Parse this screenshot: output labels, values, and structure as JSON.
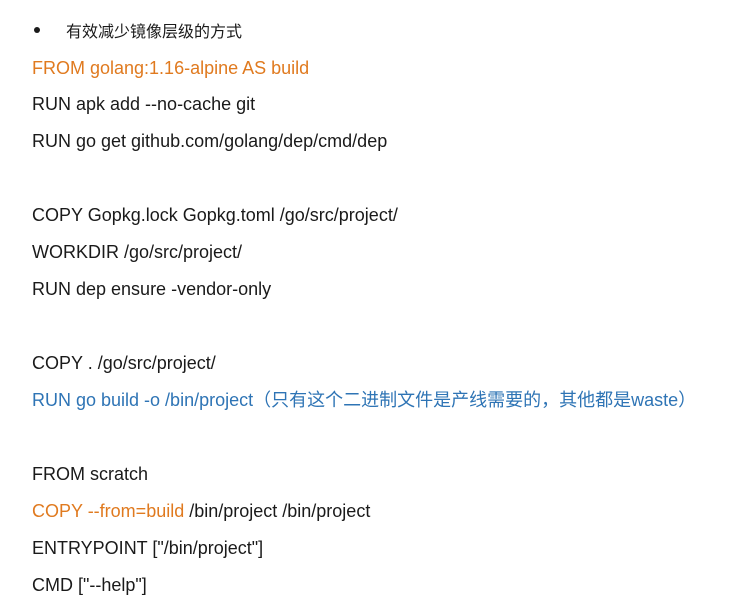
{
  "heading": "有效减少镜像层级的方式",
  "lines": {
    "l1": "FROM golang:1.16-alpine AS build",
    "l2": "RUN apk add --no-cache git",
    "l3": "RUN go get github.com/golang/dep/cmd/dep",
    "l4": "COPY Gopkg.lock Gopkg.toml /go/src/project/",
    "l5": "WORKDIR /go/src/project/",
    "l6": "RUN dep ensure -vendor-only",
    "l7": "COPY . /go/src/project/",
    "l8": "RUN go build -o /bin/project（只有这个二进制文件是产线需要的，其他都是waste）",
    "l9": "FROM scratch",
    "l10_highlight": "COPY --from=build",
    "l10_rest": " /bin/project /bin/project",
    "l11": "ENTRYPOINT [\"/bin/project\"]",
    "l12": "CMD [\"--help\"]"
  },
  "colors": {
    "orange": "#e07a1f",
    "blue": "#2e74b5",
    "text": "#1a1a1a"
  }
}
